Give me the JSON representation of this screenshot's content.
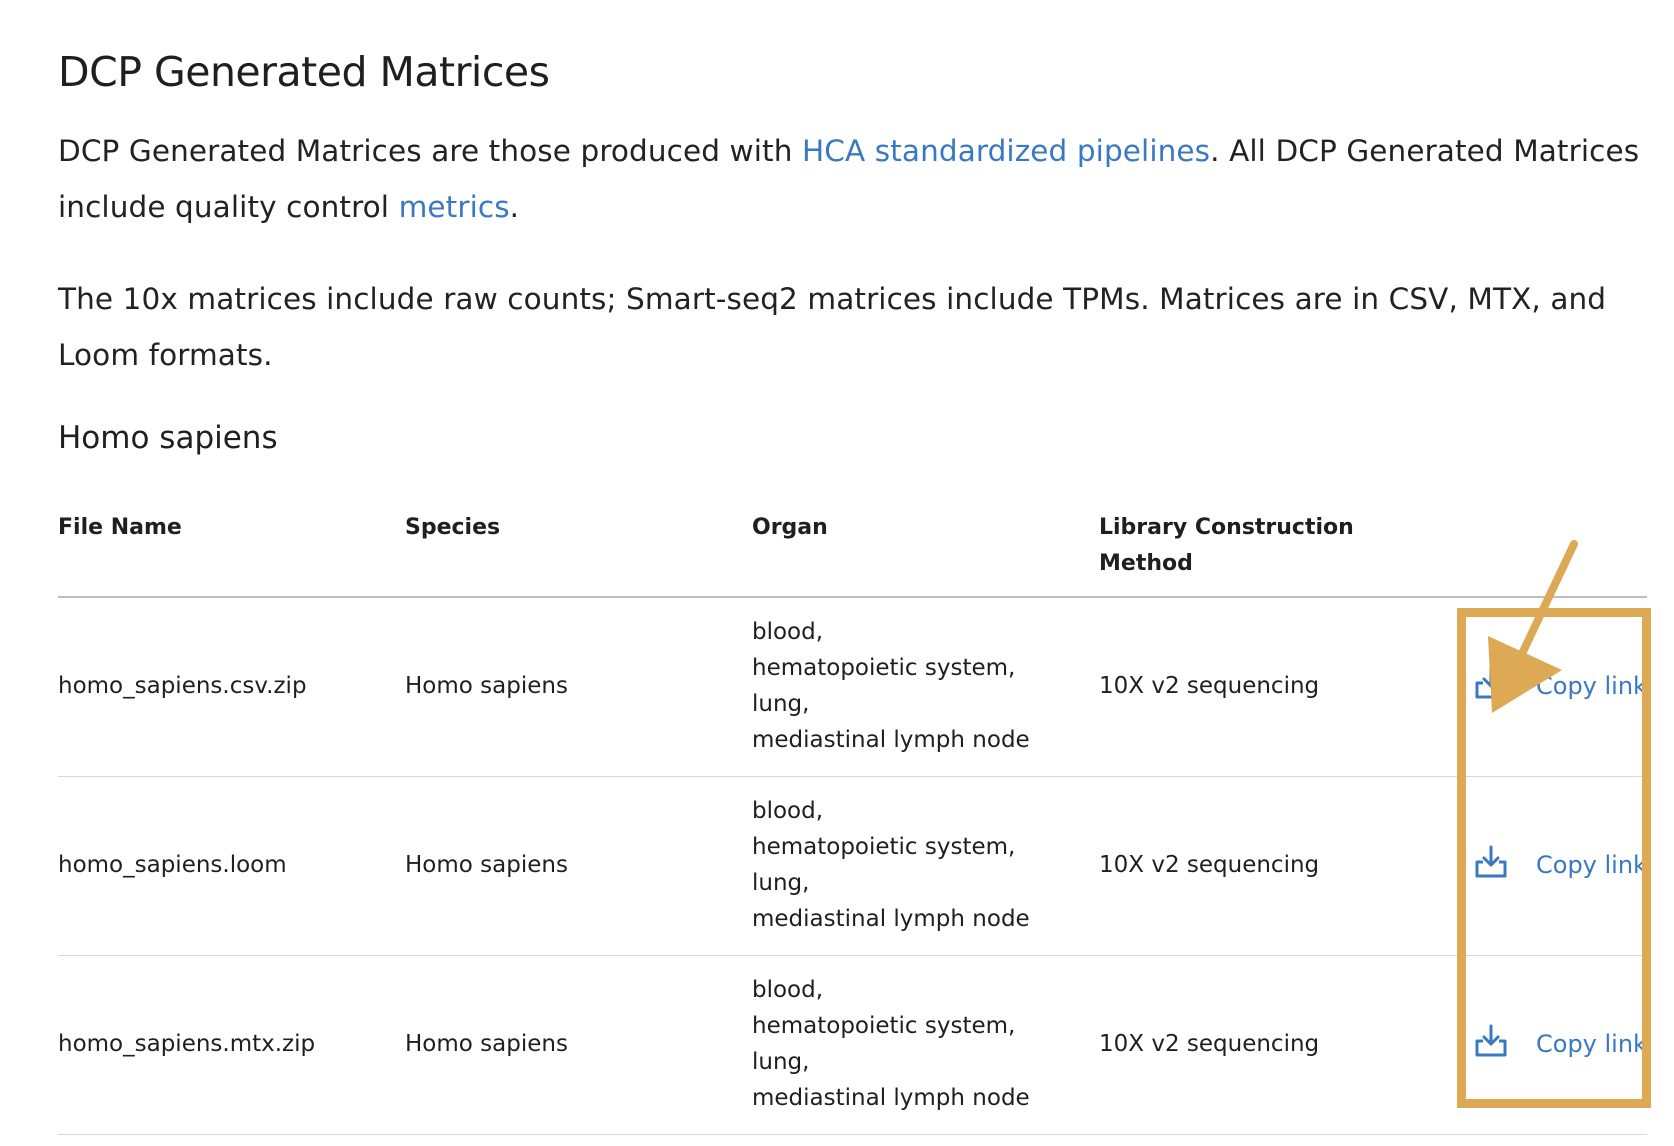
{
  "page": {
    "title": "DCP Generated Matrices",
    "intro": {
      "text_before": "DCP Generated Matrices are those produced with ",
      "link1": "HCA standardized pipelines",
      "text_middle": ". All DCP Generated Matrices include quality control ",
      "link2": "metrics",
      "text_after": "."
    },
    "formats_text": "The 10x matrices include raw counts; Smart-seq2 matrices include TPMs. Matrices are in CSV, MTX, and Loom formats."
  },
  "section": {
    "title": "Homo sapiens"
  },
  "table": {
    "headers": {
      "file_name": "File Name",
      "species": "Species",
      "organ": "Organ",
      "library_method": "Library Construction Method"
    },
    "rows": [
      {
        "file_name": "homo_sapiens.csv.zip",
        "species": "Homo sapiens",
        "organs": [
          "blood,",
          "hematopoietic system,",
          "lung,",
          "mediastinal lymph node"
        ],
        "library_method": "10X v2 sequencing",
        "download_icon": "download-icon",
        "copy_link": "Copy link"
      },
      {
        "file_name": "homo_sapiens.loom",
        "species": "Homo sapiens",
        "organs": [
          "blood,",
          "hematopoietic system,",
          "lung,",
          "mediastinal lymph node"
        ],
        "library_method": "10X v2 sequencing",
        "download_icon": "download-icon",
        "copy_link": "Copy link"
      },
      {
        "file_name": "homo_sapiens.mtx.zip",
        "species": "Homo sapiens",
        "organs": [
          "blood,",
          "hematopoietic system,",
          "lung,",
          "mediastinal lymph node"
        ],
        "library_method": "10X v2 sequencing",
        "download_icon": "download-icon",
        "copy_link": "Copy link"
      }
    ]
  },
  "colors": {
    "link": "#3a78c4",
    "highlight": "#dda954",
    "text": "#1f1f1f"
  }
}
